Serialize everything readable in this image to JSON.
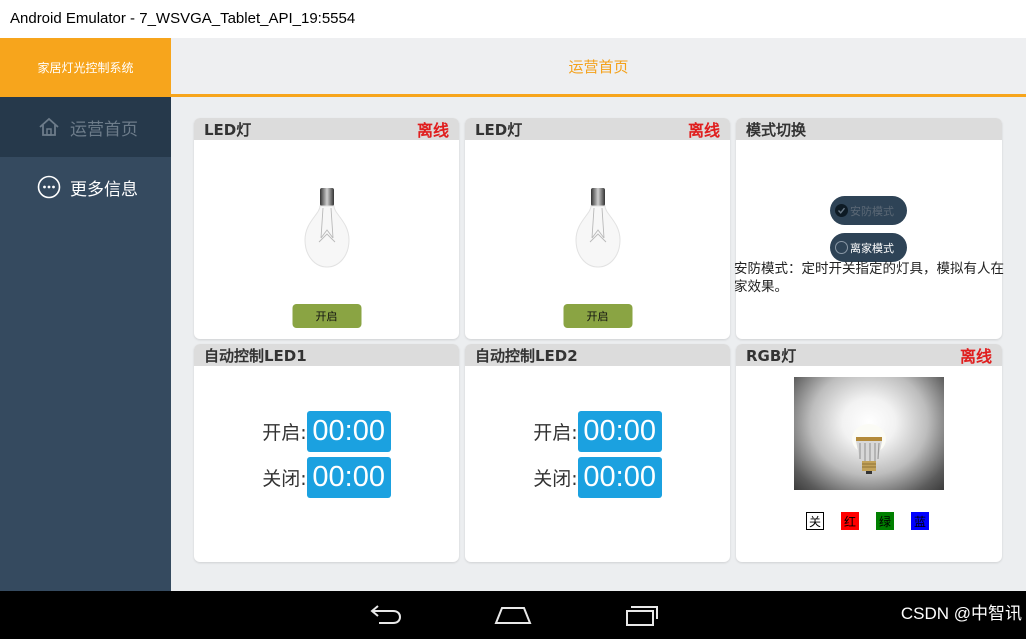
{
  "window": {
    "title": "Android Emulator - 7_WSVGA_Tablet_API_19:5554"
  },
  "app": {
    "brand": "家居灯光控制系统",
    "page_title": "运营首页"
  },
  "sidebar": {
    "items": [
      {
        "label": "运营首页",
        "icon": "home-icon",
        "active": true
      },
      {
        "label": "更多信息",
        "icon": "more-icon",
        "active": false
      }
    ]
  },
  "cards": {
    "led1": {
      "title": "LED灯",
      "status": "离线",
      "button": "开启"
    },
    "led2": {
      "title": "LED灯",
      "status": "离线",
      "button": "开启"
    },
    "mode": {
      "title": "模式切换",
      "options": [
        "安防模式",
        "离家模式"
      ],
      "description": "安防模式：定时开关指定的灯具，模拟有人在家效果。"
    },
    "auto1": {
      "title": "自动控制LED1",
      "on_label": "开启:",
      "on_time": "00:00",
      "off_label": "关闭:",
      "off_time": "00:00"
    },
    "auto2": {
      "title": "自动控制LED2",
      "on_label": "开启:",
      "on_time": "00:00",
      "off_label": "关闭:",
      "off_time": "00:00"
    },
    "rgb": {
      "title": "RGB灯",
      "status": "离线",
      "buttons": [
        "关",
        "红",
        "绿",
        "蓝"
      ]
    }
  },
  "colors": {
    "accent": "#f7a51c",
    "sidebar": "#354a5f",
    "offline": "#e01e1e",
    "open_button": "#8aa443",
    "timer": "#1ba1e0"
  },
  "watermark": "CSDN @中智讯"
}
